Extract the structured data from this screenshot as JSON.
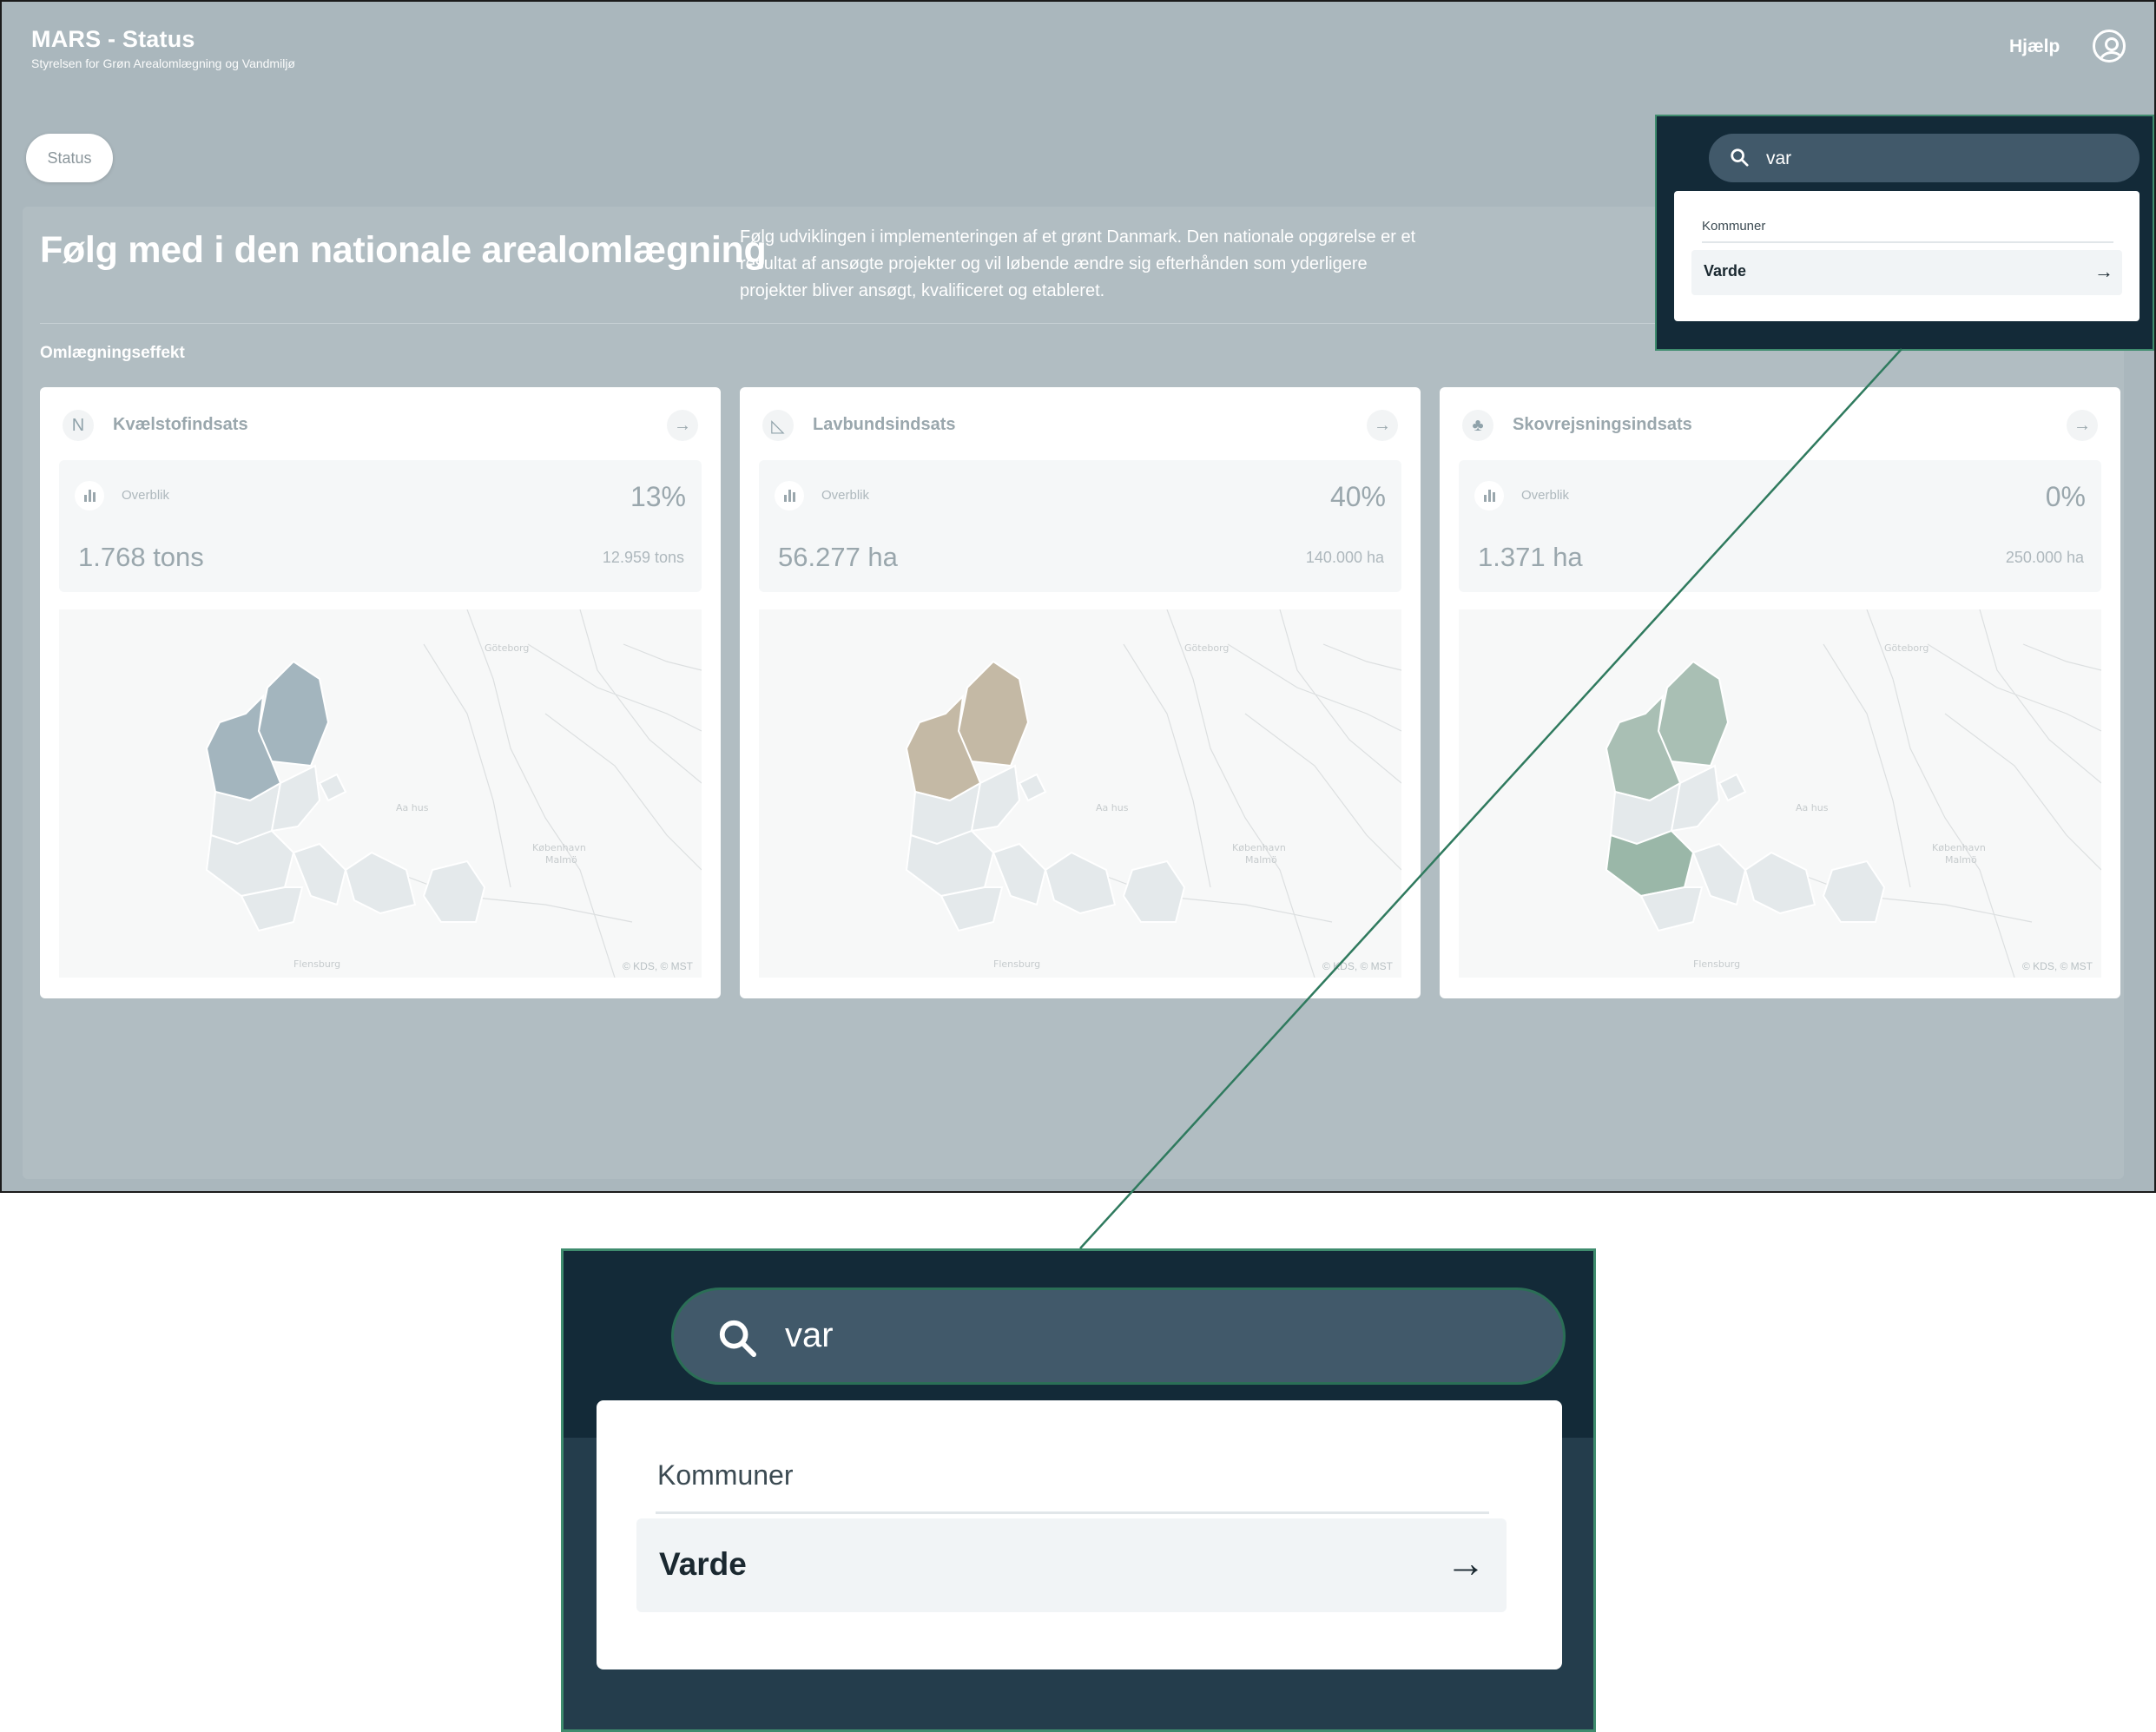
{
  "header": {
    "title": "MARS - Status",
    "subtitle": "Styrelsen for Grøn Arealomlægning og Vandmiljø",
    "help_label": "Hjælp"
  },
  "tabs": {
    "status_label": "Status"
  },
  "hero": {
    "title": "Følg med i den nationale arealomlægning",
    "description": "Følg udviklingen i implementeringen af et grønt Danmark. Den nationale opgørelse er et resultat af ansøgte projekter og vil løbende ændre sig efterhånden som yderligere projekter bliver ansøgt, kvalificeret og etableret."
  },
  "section_label": "Omlægningseffekt",
  "cards": [
    {
      "title": "Kvælstofindsats",
      "icon": "nitrogen-icon",
      "icon_glyph": "N",
      "stat_label": "Overblik",
      "percent": "13%",
      "value": "1.768 tons",
      "target": "12.959 tons",
      "accent": "#a3b5be",
      "map_credit": "© KDS, © MST"
    },
    {
      "title": "Lavbundsindsats",
      "icon": "lowland-icon",
      "icon_glyph": "◺",
      "stat_label": "Overblik",
      "percent": "40%",
      "value": "56.277 ha",
      "target": "140.000 ha",
      "accent": "#c4b9a5",
      "map_credit": "© KDS, © MST"
    },
    {
      "title": "Skovrejsningsindsats",
      "icon": "forest-icon",
      "icon_glyph": "♣",
      "stat_label": "Overblik",
      "percent": "0%",
      "value": "1.371 ha",
      "target": "250.000 ha",
      "accent": "#a9bfb4",
      "map_credit": "© KDS, © MST"
    }
  ],
  "search": {
    "query": "var",
    "group_heading": "Kommuner",
    "result_label": "Varde"
  },
  "map_labels": {
    "goteborg": "Göteborg",
    "aarhus": "Aa hus",
    "kobenhavn": "København",
    "malmo": "Malmö",
    "flensburg": "Flensburg"
  },
  "colors": {
    "overlay_bg": "#132a38",
    "highlight_border": "#3f8c6e",
    "panel_bg": "#b1bdc2"
  }
}
